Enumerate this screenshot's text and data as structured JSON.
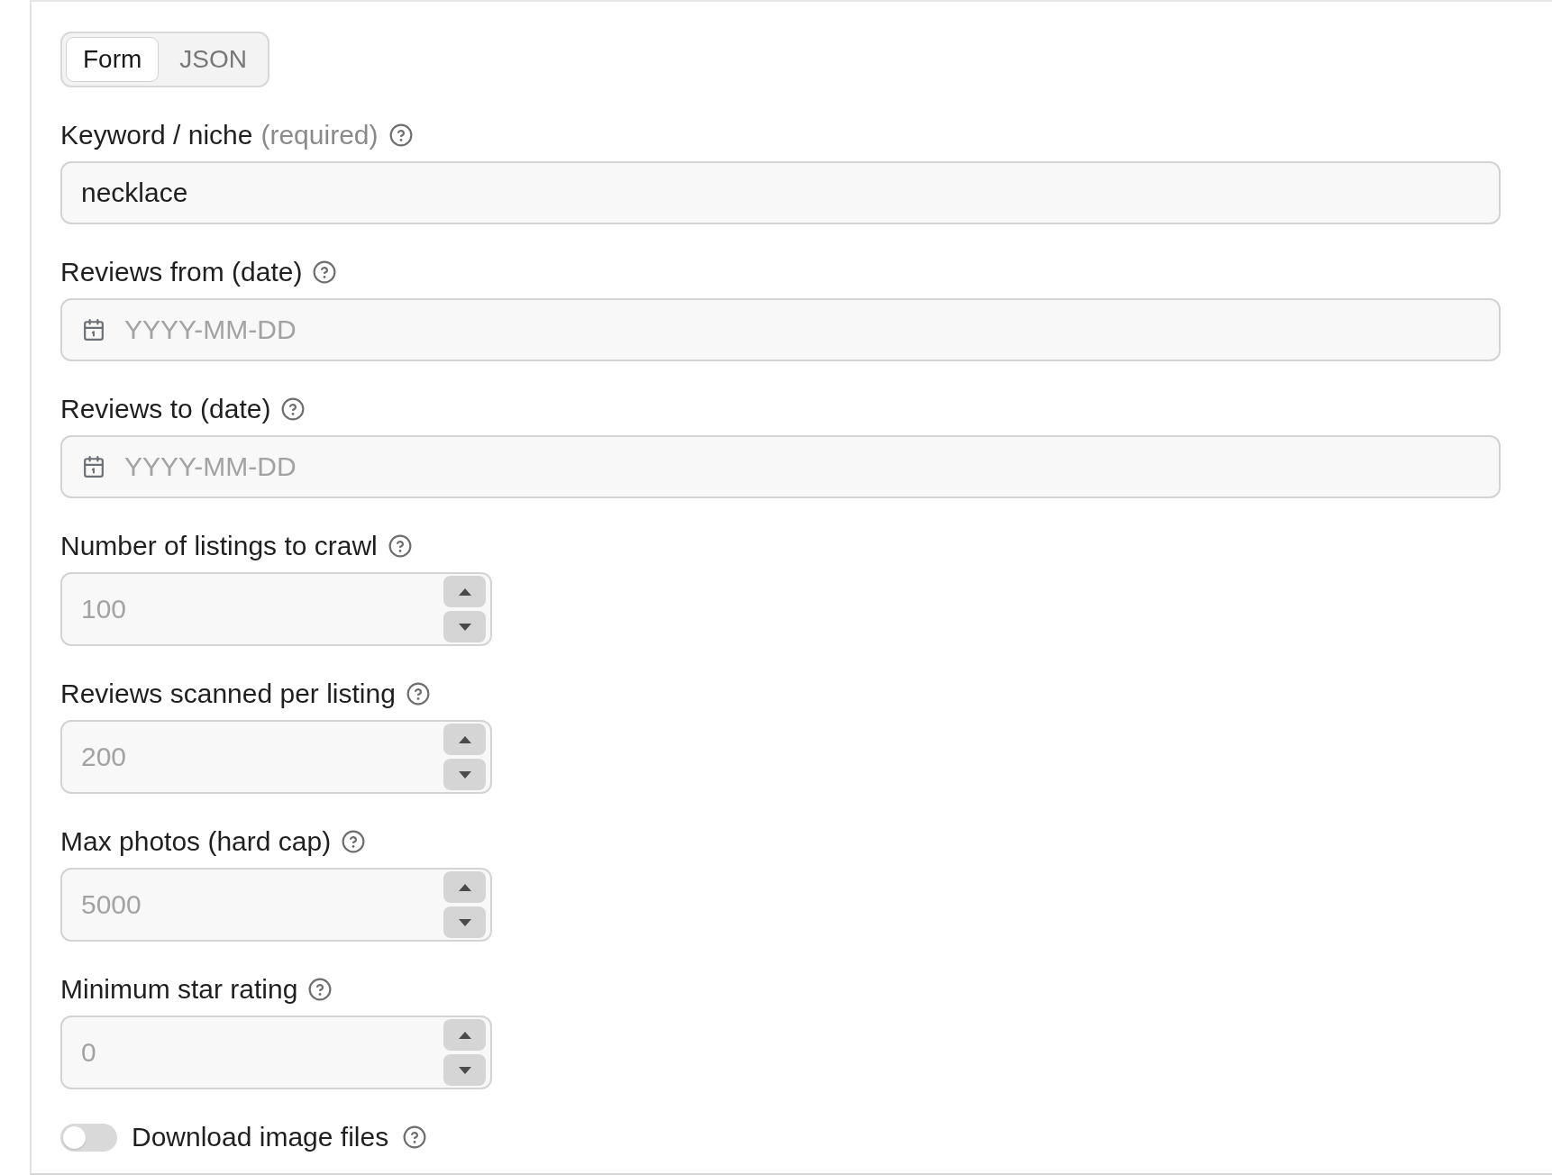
{
  "mode_tabs": [
    {
      "label": "Form",
      "selected": true
    },
    {
      "label": "JSON",
      "selected": false
    }
  ],
  "fields": [
    {
      "kind": "text",
      "label": "Keyword / niche",
      "note": "(required)",
      "value": "necklace"
    },
    {
      "kind": "date",
      "label": "Reviews from (date)",
      "placeholder": "YYYY-MM-DD"
    },
    {
      "kind": "date",
      "label": "Reviews to (date)",
      "placeholder": "YYYY-MM-DD"
    },
    {
      "kind": "number",
      "label": "Number of listings to crawl",
      "placeholder": "100"
    },
    {
      "kind": "number",
      "label": "Reviews scanned per listing",
      "placeholder": "200"
    },
    {
      "kind": "number",
      "label": "Max photos (hard cap)",
      "placeholder": "5000"
    },
    {
      "kind": "number",
      "label": "Minimum star rating",
      "placeholder": "0"
    },
    {
      "kind": "toggle",
      "label": "Download image files",
      "on": false
    }
  ]
}
